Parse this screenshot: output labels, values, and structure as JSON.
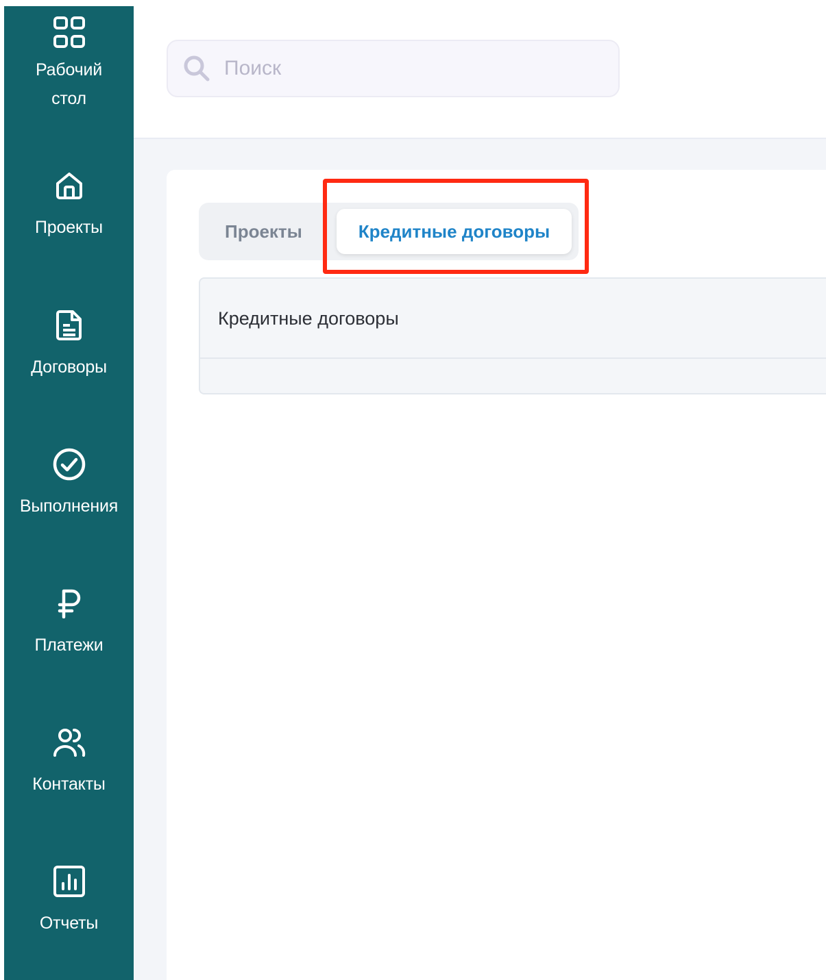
{
  "sidebar": {
    "items": [
      {
        "label_line1": "Рабочий",
        "label_line2": "стол",
        "icon": "dashboard-grid-icon"
      },
      {
        "label": "Проекты",
        "icon": "home-icon"
      },
      {
        "label": "Договоры",
        "icon": "document-icon"
      },
      {
        "label": "Выполнения",
        "icon": "check-circle-icon"
      },
      {
        "label": "Платежи",
        "icon": "ruble-icon"
      },
      {
        "label": "Контакты",
        "icon": "users-icon"
      },
      {
        "label": "Отчеты",
        "icon": "bar-chart-icon"
      }
    ],
    "background": "#12636b"
  },
  "search": {
    "placeholder": "Поиск",
    "value": ""
  },
  "tabs": {
    "items": [
      {
        "label": "Проекты",
        "active": false
      },
      {
        "label": "Кредитные договоры",
        "active": true
      }
    ],
    "active_color": "#1f84c8",
    "highlight_color": "#ff2a12"
  },
  "panel": {
    "title": "Кредитные договоры"
  }
}
